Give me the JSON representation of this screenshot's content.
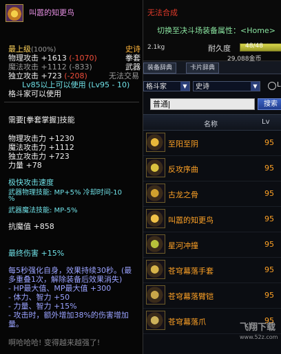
{
  "window": {
    "cannot_synthesize": "无法合成",
    "switch_attr": "切换至决斗场装备属性：<Home>",
    "weight": "2.1kg",
    "durability_label": "耐久度",
    "durability_value": "48/48",
    "durability_fraction": 1.0,
    "price": "29,088金币",
    "tabs": [
      "装备辞典",
      "卡片辞典"
    ],
    "job_select": "格斗家",
    "rarity_select": "史诗",
    "lv_label": "Lv",
    "search_value": "普通",
    "search_button": "搜索",
    "col_name": "名称",
    "col_lv": "Lv",
    "watermark_title": "飞翔下载",
    "watermark_url": "www.52z.com"
  },
  "items": [
    {
      "name": "至阳至阴",
      "lv": "95",
      "icon_color": "#e8b83a"
    },
    {
      "name": "反攻序曲",
      "lv": "95",
      "icon_color": "#d9c23f"
    },
    {
      "name": "古龙之骨",
      "lv": "95",
      "icon_color": "#cfa02e"
    },
    {
      "name": "叫嚣的知更鸟",
      "lv": "95",
      "icon_color": "#f0c248"
    },
    {
      "name": "星河冲撞",
      "lv": "95",
      "icon_color": "#b7c23b"
    },
    {
      "name": "苍穹幕落手套",
      "lv": "95",
      "icon_color": "#d7b44a"
    },
    {
      "name": "苍穹幕落臂铠",
      "lv": "95",
      "icon_color": "#c9a64a"
    },
    {
      "name": "苍穹幕落爪",
      "lv": "95",
      "icon_color": "#cdb25a"
    }
  ],
  "tooltip": {
    "name": "叫嚣的知更鸟",
    "top_grade": "最上级",
    "grade_pct": "(100%)",
    "rarity": "史诗",
    "phys_atk_label": "物理攻击",
    "phys_atk_val": "+1613",
    "phys_atk_diff": "(-1070)",
    "weapon_type": "拳套",
    "mag_atk_label": "魔法攻击",
    "mag_atk_val": "+1112",
    "mag_atk_diff": "(-833)",
    "category": "武器",
    "ind_atk_label": "独立攻击",
    "ind_atk_val": "+723",
    "ind_atk_diff": "(-208)",
    "no_trade": "无法交易",
    "level_req": "Lv85以上可以使用 (Lv95 - 10)",
    "class_req": "格斗家可以使用",
    "skill_req": "需要[拳套掌握]技能",
    "stat1": "物理攻击力 +1230",
    "stat2": "魔法攻击力 +1112",
    "stat3": "独立攻击力 +723",
    "stat4": "力量 +78",
    "speed_title": "极快攻击速度",
    "skill_phys": "武器物理技能:  MP+5% 冷却时间-10",
    "skill_phys_cont": "%",
    "skill_mag": "武器魔法技能:  MP-5%",
    "resist": "抗魔值 +858",
    "final_dmg": "最终伤害 +15%",
    "effect1": "每5秒强化自身，效果持续30秒。(最",
    "effect2": "多重叠1次，解除装备后效果消失)",
    "effect3": "- HP最大值、MP最大值 +300",
    "effect4": "- 体力、智力 +50",
    "effect5": "- 力量、智力 +15%",
    "effect6": "- 攻击时，额外增加38%的伤害增加",
    "effect7": "量。",
    "flavor": "啊哈哈哈! 变得越来越强了!"
  }
}
